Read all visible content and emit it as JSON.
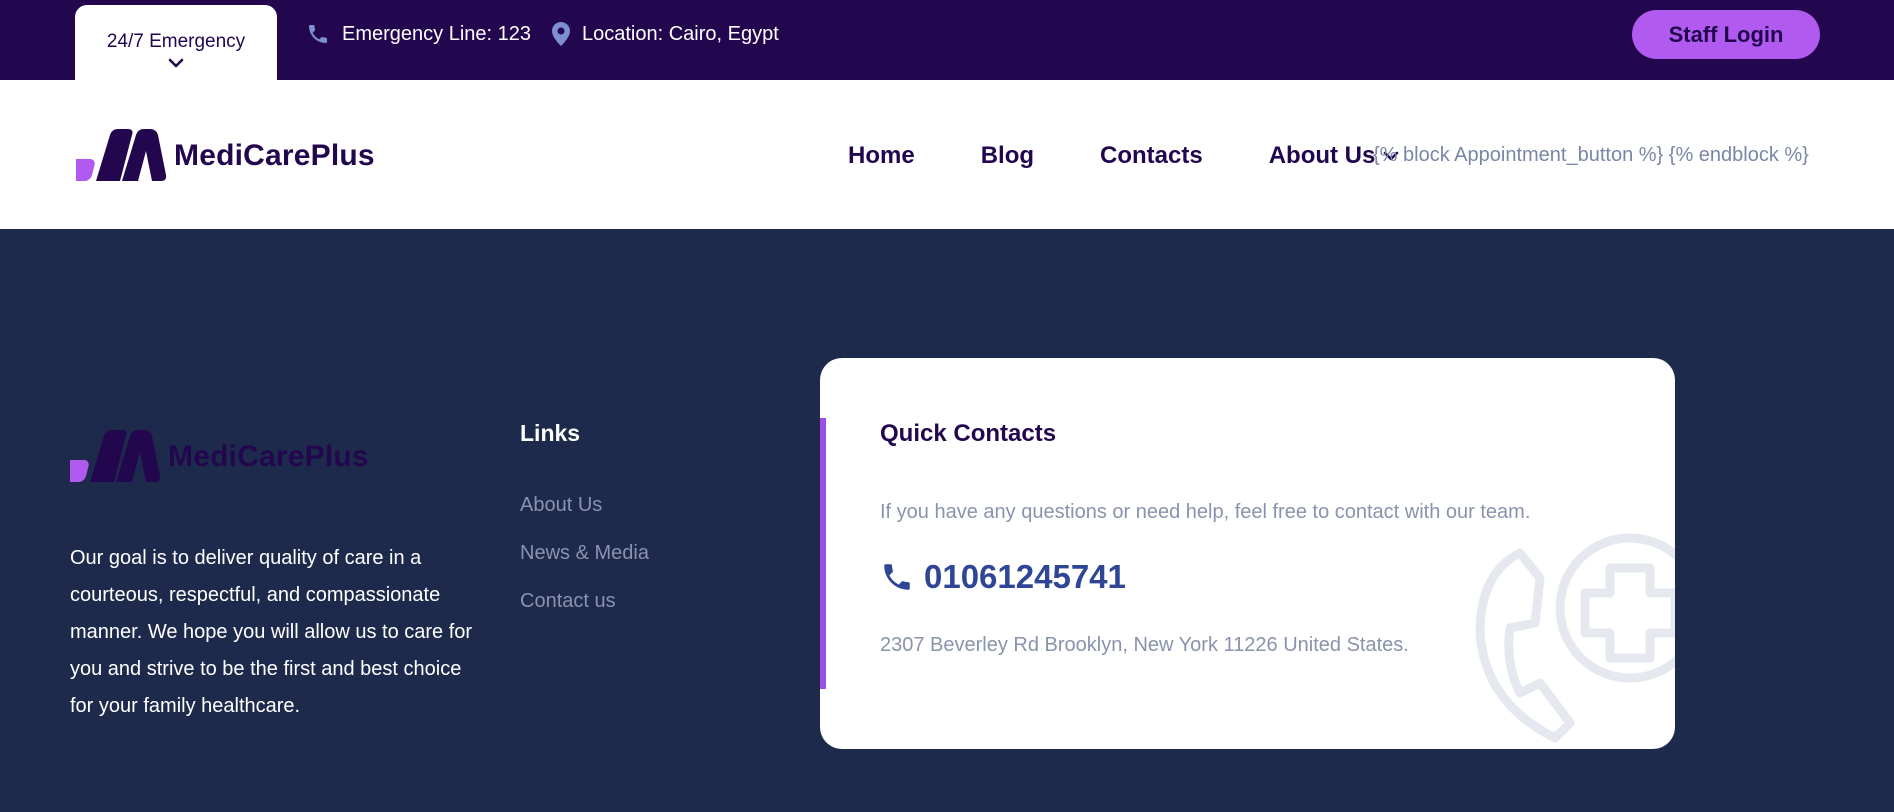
{
  "topbar": {
    "emergency_tab_label": "24/7 Emergency",
    "emergency_line": "Emergency Line: 123",
    "location": "Location: Cairo, Egypt",
    "staff_login_label": "Staff Login"
  },
  "brand": {
    "name": "MediCarePlus",
    "colors": {
      "topbar_bg": "#22074f",
      "accent": "#b05af0",
      "footer_bg": "#1e2a4c",
      "phone_blue": "#2f4696"
    }
  },
  "nav": {
    "items": [
      {
        "label": "Home"
      },
      {
        "label": "Blog"
      },
      {
        "label": "Contacts"
      },
      {
        "label": "About Us"
      }
    ],
    "template_text": "{% block Appointment_button %} {% endblock %}"
  },
  "footer": {
    "logo_name": "MediCarePlus",
    "description": "Our goal is to deliver quality of care in a courteous, respectful, and compassionate manner. We hope you will allow us to care for you and strive to be the first and best choice for your family healthcare.",
    "links_title": "Links",
    "links": [
      {
        "label": "About Us"
      },
      {
        "label": "News & Media"
      },
      {
        "label": "Contact us"
      }
    ]
  },
  "quick_contacts": {
    "title": "Quick Contacts",
    "subtitle": "If you have any questions or need help, feel free to contact with our team.",
    "phone": "01061245741",
    "address": "2307 Beverley Rd Brooklyn, New York 11226 United States."
  },
  "icons": [
    "chevron-down-icon",
    "phone-icon",
    "location-pin-icon",
    "logo-mark-icon",
    "phone-medical-watermark-icon"
  ]
}
